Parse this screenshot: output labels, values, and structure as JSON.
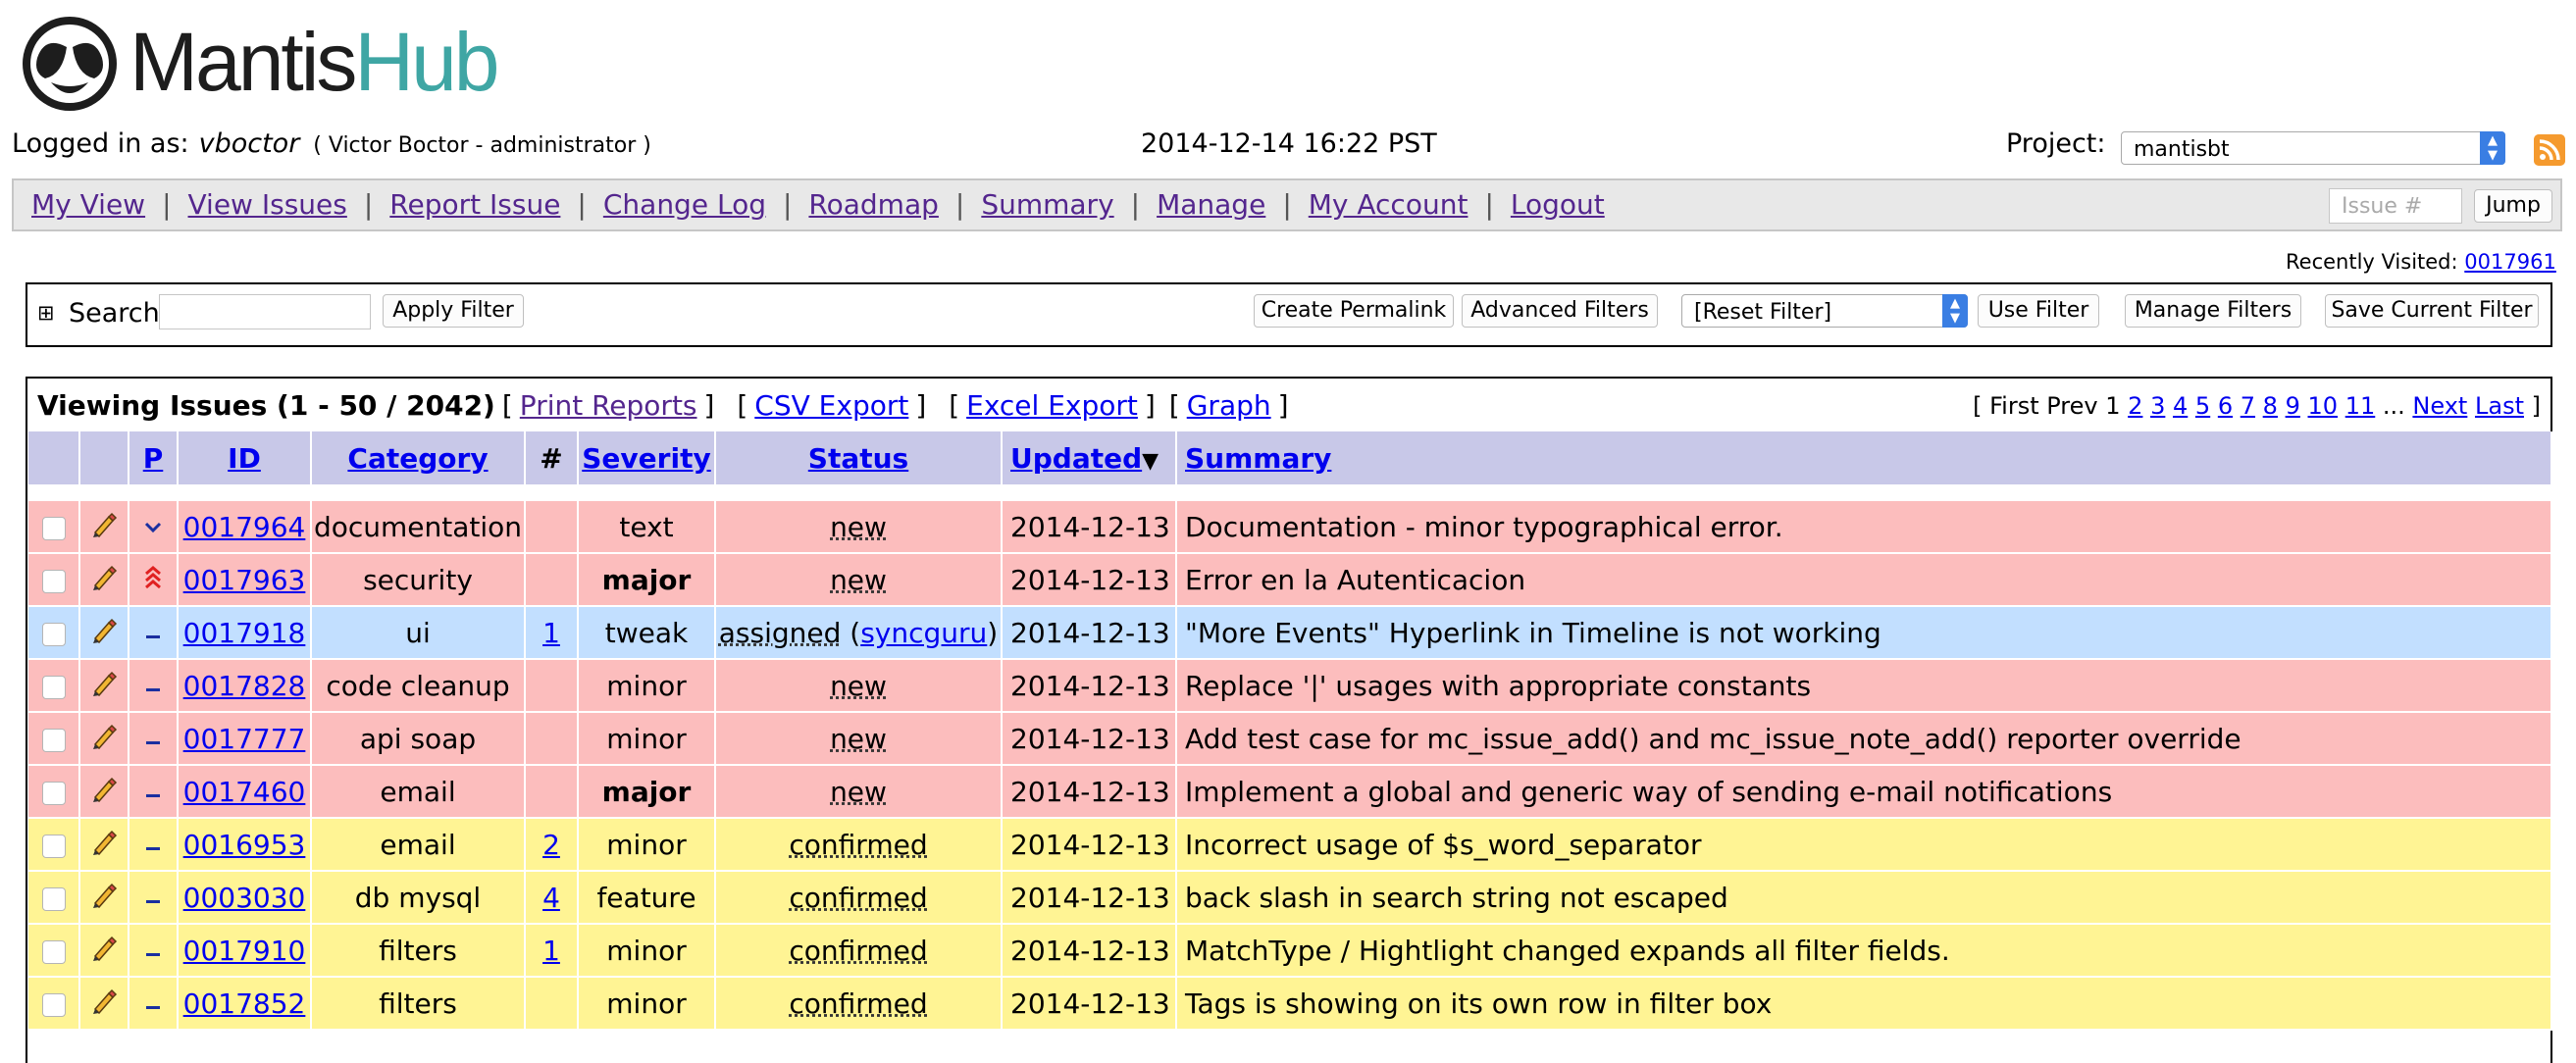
{
  "header": {
    "brand_part1": "Mantis",
    "brand_part2": "Hub",
    "logged_in_label": "Logged in as:",
    "username": "vboctor",
    "user_fullname": "( Victor Boctor - administrator )",
    "timestamp": "2014-12-14 16:22 PST",
    "project_label": "Project:",
    "project_value": "mantisbt"
  },
  "menu": {
    "items": [
      "My View",
      "View Issues",
      "Report Issue",
      "Change Log",
      "Roadmap",
      "Summary",
      "Manage",
      "My Account",
      "Logout"
    ],
    "issue_placeholder": "Issue #",
    "jump_label": "Jump"
  },
  "recently_visited": {
    "label": "Recently Visited:",
    "issue": "0017961"
  },
  "filter": {
    "search_label": "Search",
    "apply_label": "Apply Filter",
    "permalink_label": "Create Permalink",
    "advanced_label": "Advanced Filters",
    "select_value": "[Reset Filter]",
    "use_label": "Use Filter",
    "manage_label": "Manage Filters",
    "save_label": "Save Current Filter"
  },
  "issues": {
    "viewing_text": "Viewing Issues (1 - 50 / 2042)",
    "links": [
      "Print Reports",
      "CSV Export",
      "Excel Export",
      "Graph"
    ],
    "pager_prefix": "[ First Prev 1",
    "pager_pages": [
      "2",
      "3",
      "4",
      "5",
      "6",
      "7",
      "8",
      "9",
      "10",
      "11"
    ],
    "pager_ellipsis": "...",
    "pager_next": "Next",
    "pager_last": "Last",
    "pager_suffix": "]",
    "columns": [
      "P",
      "ID",
      "Category",
      "#",
      "Severity",
      "Status",
      "Updated",
      "Summary"
    ],
    "rows": [
      {
        "priority": "low",
        "id": "0017964",
        "category": "documentation",
        "notes": "",
        "severity": "text",
        "status": "new",
        "handler": "",
        "updated": "2014-12-13",
        "summary": "Documentation - minor typographical error.",
        "color": "#fcbdbd"
      },
      {
        "priority": "urgent",
        "id": "0017963",
        "category": "security",
        "notes": "",
        "severity": "major",
        "status": "new",
        "handler": "",
        "updated": "2014-12-13",
        "summary": "Error en la Autenticacion",
        "color": "#fcbdbd"
      },
      {
        "priority": "normal",
        "id": "0017918",
        "category": "ui",
        "notes": "1",
        "severity": "tweak",
        "status": "assigned",
        "handler": "syncguru",
        "updated": "2014-12-13",
        "summary": "\"More Events\" Hyperlink in Timeline is not working",
        "color": "#c2dfff"
      },
      {
        "priority": "normal",
        "id": "0017828",
        "category": "code cleanup",
        "notes": "",
        "severity": "minor",
        "status": "new",
        "handler": "",
        "updated": "2014-12-13",
        "summary": "Replace '|' usages with appropriate constants",
        "color": "#fcbdbd"
      },
      {
        "priority": "normal",
        "id": "0017777",
        "category": "api soap",
        "notes": "",
        "severity": "minor",
        "status": "new",
        "handler": "",
        "updated": "2014-12-13",
        "summary": "Add test case for mc_issue_add() and mc_issue_note_add() reporter override",
        "color": "#fcbdbd"
      },
      {
        "priority": "normal",
        "id": "0017460",
        "category": "email",
        "notes": "",
        "severity": "major",
        "status": "new",
        "handler": "",
        "updated": "2014-12-13",
        "summary": "Implement a global and generic way of sending e-mail notifications",
        "color": "#fcbdbd"
      },
      {
        "priority": "normal",
        "id": "0016953",
        "category": "email",
        "notes": "2",
        "severity": "minor",
        "status": "confirmed",
        "handler": "",
        "updated": "2014-12-13",
        "summary": "Incorrect usage of $s_word_separator",
        "color": "#fff494"
      },
      {
        "priority": "normal",
        "id": "0003030",
        "category": "db mysql",
        "notes": "4",
        "severity": "feature",
        "status": "confirmed",
        "handler": "",
        "updated": "2014-12-13",
        "summary": "back slash in search string not escaped",
        "color": "#fff494"
      },
      {
        "priority": "normal",
        "id": "0017910",
        "category": "filters",
        "notes": "1",
        "severity": "minor",
        "status": "confirmed",
        "handler": "",
        "updated": "2014-12-13",
        "summary": "MatchType / Hightlight changed expands all filter fields.",
        "color": "#fff494"
      },
      {
        "priority": "normal",
        "id": "0017852",
        "category": "filters",
        "notes": "",
        "severity": "minor",
        "status": "confirmed",
        "handler": "",
        "updated": "2014-12-13",
        "summary": "Tags is showing on its own row in filter box",
        "color": "#fff494"
      }
    ]
  },
  "colors": {
    "new": "#fcbdbd",
    "assigned": "#c2dfff",
    "confirmed": "#fff494",
    "header_row": "#c8c8e8",
    "menu_bg": "#e8e8e8",
    "brand_accent": "#3fa6a4"
  }
}
